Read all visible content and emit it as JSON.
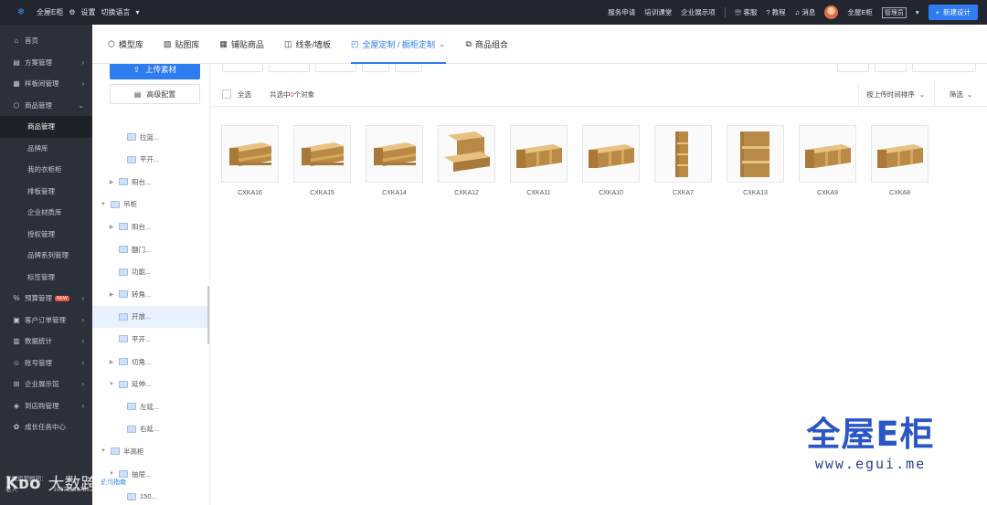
{
  "topbar": {
    "app_name": "全屋E柜",
    "settings": "设置",
    "switch_lang": "切换语言",
    "links": [
      "服务申请",
      "培训课堂",
      "企业展示项"
    ],
    "service": "客服",
    "tutorial": "教程",
    "messages": "消息",
    "username": "全屋E柜",
    "role": "管理员",
    "new_design": "新建设计"
  },
  "sidebar": {
    "items": [
      {
        "label": "首页",
        "icon": "home-icon",
        "expandable": false
      },
      {
        "label": "方案管理",
        "icon": "layout-icon",
        "expandable": true
      },
      {
        "label": "样板间管理",
        "icon": "room-icon",
        "expandable": true
      },
      {
        "label": "商品管理",
        "icon": "box-icon",
        "expandable": true,
        "expanded": true
      }
    ],
    "sub_items": [
      "商品管理",
      "品牌库",
      "我的衣柜柜",
      "排板管理",
      "企业材质库",
      "授权管理",
      "品牌系列管理",
      "标签管理"
    ],
    "items2": [
      {
        "label": "预算管理",
        "icon": "budget-icon",
        "badge": "NEW"
      },
      {
        "label": "客户订单管理",
        "icon": "order-icon"
      },
      {
        "label": "数据统计",
        "icon": "chart-icon"
      },
      {
        "label": "账号管理",
        "icon": "user-icon"
      },
      {
        "label": "企业展示馆",
        "icon": "grid-icon"
      },
      {
        "label": "到店购管理",
        "icon": "diamond-icon"
      },
      {
        "label": "成长任务中心",
        "icon": "task-icon"
      }
    ],
    "footer_title": "专属运营顾问：",
    "footer_name": "老人",
    "footer_phone": "19975256786"
  },
  "tabs": [
    {
      "label": "模型库",
      "icon": "cube-icon"
    },
    {
      "label": "贴图库",
      "icon": "image-icon"
    },
    {
      "label": "铺贴商品",
      "icon": "tile-icon"
    },
    {
      "label": "线条/墙板",
      "icon": "line-icon"
    },
    {
      "label": "全屋定制 / 橱柜定制",
      "icon": "cabinet-icon",
      "active": true
    },
    {
      "label": "商品组合",
      "icon": "combo-icon"
    }
  ],
  "panel": {
    "upload": "上传素材",
    "advanced": "高级配置",
    "tree": [
      {
        "label": "拉篮...",
        "level": 3,
        "arrow": false
      },
      {
        "label": "平开...",
        "level": 3,
        "arrow": false
      },
      {
        "label": "阳台...",
        "level": 2,
        "arrow": true
      },
      {
        "label": "吊柜",
        "level": 1,
        "arrow": true,
        "open": true
      },
      {
        "label": "阳台...",
        "level": 2,
        "arrow": true
      },
      {
        "label": "翻门...",
        "level": 2,
        "arrow": false
      },
      {
        "label": "功能...",
        "level": 2,
        "arrow": false
      },
      {
        "label": "转角...",
        "level": 2,
        "arrow": true
      },
      {
        "label": "开放...",
        "level": 2,
        "arrow": false,
        "selected": true
      },
      {
        "label": "平开...",
        "level": 2,
        "arrow": false
      },
      {
        "label": "切角...",
        "level": 2,
        "arrow": true
      },
      {
        "label": "延伸...",
        "level": 2,
        "arrow": true,
        "open": true
      },
      {
        "label": "左延...",
        "level": 3,
        "arrow": false
      },
      {
        "label": "右延...",
        "level": 3,
        "arrow": false
      },
      {
        "label": "半高柜",
        "level": 1,
        "arrow": true,
        "open": true
      },
      {
        "label": "抽屉...",
        "level": 2,
        "arrow": true,
        "open": true
      },
      {
        "label": "150...",
        "level": 3,
        "arrow": false
      }
    ]
  },
  "listing": {
    "select_all": "全选",
    "count_prefix": "共选中",
    "count_num": "0",
    "count_suffix": "个对象",
    "sort": "按上传时间排序",
    "filter": "筛选",
    "products": [
      {
        "name": "CXKA16",
        "shape": "shelf-low"
      },
      {
        "name": "CXKA15",
        "shape": "shelf-wide"
      },
      {
        "name": "CXKA14",
        "shape": "shelf-low"
      },
      {
        "name": "CXKA12",
        "shape": "desk"
      },
      {
        "name": "CXKA11",
        "shape": "open-3"
      },
      {
        "name": "CXKA10",
        "shape": "open-3"
      },
      {
        "name": "CXKA7",
        "shape": "tall"
      },
      {
        "name": "CXKA13",
        "shape": "tower"
      },
      {
        "name": "CXKA9",
        "shape": "open-long"
      },
      {
        "name": "CXKA8",
        "shape": "open-long"
      }
    ]
  },
  "guide_link": "使用指南",
  "brand": {
    "logo_text": "全屋E柜",
    "url": "www.egui.me"
  },
  "watermark": {
    "logo": "Kᴅᴏ",
    "text": "大数跨境"
  }
}
